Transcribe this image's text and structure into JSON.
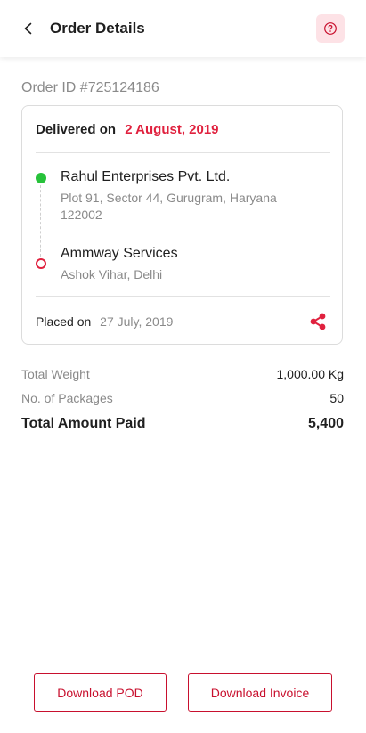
{
  "header": {
    "title": "Order Details"
  },
  "order": {
    "id_label": "Order ID #725124186",
    "delivered_label": "Delivered on",
    "delivered_date": "2 August, 2019",
    "from": {
      "name": "Rahul Enterprises Pvt. Ltd.",
      "address": "Plot 91, Sector 44, Gurugram, Haryana 122002"
    },
    "to": {
      "name": "Ammway Services",
      "address": "Ashok Vihar, Delhi"
    },
    "placed_label": "Placed on",
    "placed_date": "27 July, 2019"
  },
  "summary": {
    "weight_label": "Total Weight",
    "weight_value": "1,000.00 Kg",
    "packages_label": "No. of Packages",
    "packages_value": "50",
    "total_label": "Total Amount Paid",
    "total_value": "5,400"
  },
  "actions": {
    "download_pod": "Download POD",
    "download_invoice": "Download Invoice"
  },
  "icons": {
    "back": "chevron-left-icon",
    "help": "question-circle-icon",
    "share": "share-icon"
  },
  "colors": {
    "accent": "#e0213e",
    "button_border": "#c8102e",
    "success": "#27c23a",
    "help_bg": "#fde2e6"
  }
}
